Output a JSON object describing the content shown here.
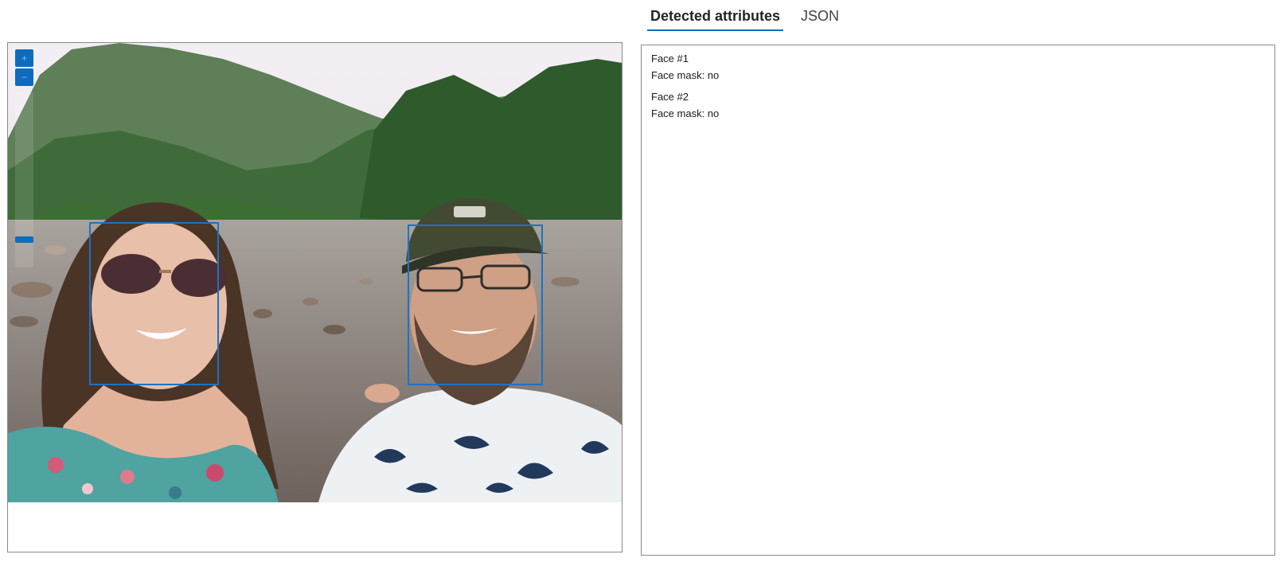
{
  "tabs": [
    {
      "label": "Detected attributes",
      "active": true
    },
    {
      "label": "JSON",
      "active": false
    }
  ],
  "viewer": {
    "zoom_in_icon": "plus-icon",
    "zoom_out_icon": "minus-icon",
    "accent_color": "#0f6cbd",
    "face_box_color": "#1a73c9"
  },
  "faces": [
    {
      "title": "Face #1",
      "attribute": "Face mask: no"
    },
    {
      "title": "Face #2",
      "attribute": "Face mask: no"
    }
  ]
}
